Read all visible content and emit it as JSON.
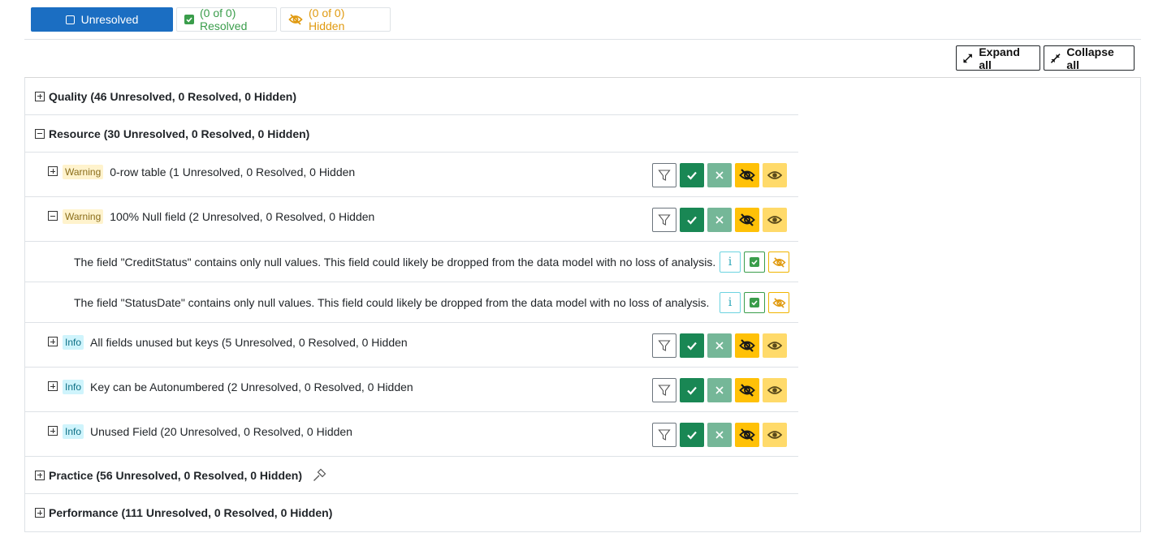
{
  "tabs": {
    "unresolved": "Unresolved",
    "resolved": "(0 of 0) Resolved",
    "hidden": "(0 of 0) Hidden"
  },
  "actions": {
    "expand_all": "Expand all",
    "collapse_all": "Collapse all"
  },
  "categories": [
    {
      "label": "Quality (46 Unresolved, 0 Resolved, 0 Hidden)",
      "expanded": false
    },
    {
      "label": "Resource (30 Unresolved, 0 Resolved, 0 Hidden)",
      "expanded": true,
      "rules": [
        {
          "severity": "Warning",
          "title": "0-row table (1 Unresolved, 0 Resolved, 0 Hidden",
          "expanded": false
        },
        {
          "severity": "Warning",
          "title": "100% Null field (2 Unresolved, 0 Resolved, 0 Hidden",
          "expanded": true,
          "issues": [
            "The field \"CreditStatus\" contains only null values. This field could likely be dropped from the data model with no loss of analysis.",
            "The field \"StatusDate\" contains only null values. This field could likely be dropped from the data model with no loss of analysis."
          ]
        },
        {
          "severity": "Info",
          "title": "All fields unused but keys (5 Unresolved, 0 Resolved, 0 Hidden",
          "expanded": false
        },
        {
          "severity": "Info",
          "title": "Key can be Autonumbered (2 Unresolved, 0 Resolved, 0 Hidden",
          "expanded": false
        },
        {
          "severity": "Info",
          "title": "Unused Field (20 Unresolved, 0 Resolved, 0 Hidden",
          "expanded": false
        }
      ]
    },
    {
      "label": "Practice (56 Unresolved, 0 Resolved, 0 Hidden)",
      "expanded": false,
      "icon": "hammer-icon"
    },
    {
      "label": "Performance (111 Unresolved, 0 Resolved, 0 Hidden)",
      "expanded": false
    }
  ],
  "info_glyph": "i",
  "colors": {
    "primary": "#1b6ec2",
    "success": "#198754",
    "warning": "#ffc107",
    "info": "#0dcaf0"
  }
}
